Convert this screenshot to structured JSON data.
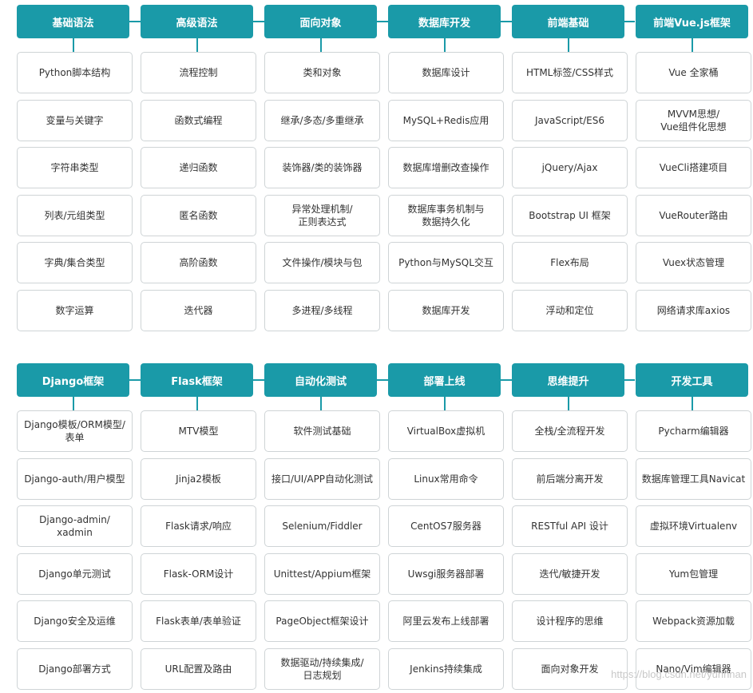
{
  "sections": [
    {
      "columns": [
        {
          "title": "基础语法",
          "items": [
            "Python脚本结构",
            "变量与关键字",
            "字符串类型",
            "列表/元组类型",
            "字典/集合类型",
            "数字运算"
          ]
        },
        {
          "title": "高级语法",
          "items": [
            "流程控制",
            "函数式编程",
            "递归函数",
            "匿名函数",
            "高阶函数",
            "迭代器"
          ]
        },
        {
          "title": "面向对象",
          "items": [
            "类和对象",
            "继承/多态/多重继承",
            "装饰器/类的装饰器",
            "异常处理机制/\n正则表达式",
            "文件操作/模块与包",
            "多进程/多线程"
          ]
        },
        {
          "title": "数据库开发",
          "items": [
            "数据库设计",
            "MySQL+Redis应用",
            "数据库增删改查操作",
            "数据库事务机制与\n数据持久化",
            "Python与MySQL交互",
            "数据库开发"
          ]
        },
        {
          "title": "前端基础",
          "items": [
            "HTML标签/CSS样式",
            "JavaScript/ES6",
            "jQuery/Ajax",
            "Bootstrap UI 框架",
            "Flex布局",
            "浮动和定位"
          ]
        },
        {
          "title": "前端Vue.js框架",
          "items": [
            "Vue 全家桶",
            "MVVM思想/\nVue组件化思想",
            "VueCli搭建项目",
            "VueRouter路由",
            "Vuex状态管理",
            "网络请求库axios"
          ]
        }
      ]
    },
    {
      "columns": [
        {
          "title": "Django框架",
          "items": [
            "Django模板/ORM模型/\n表单",
            "Django-auth/用户模型",
            "Django-admin/\nxadmin",
            "Django单元测试",
            "Django安全及运维",
            "Django部署方式"
          ]
        },
        {
          "title": "Flask框架",
          "items": [
            "MTV模型",
            "Jinja2模板",
            "Flask请求/响应",
            "Flask-ORM设计",
            "Flask表单/表单验证",
            "URL配置及路由"
          ]
        },
        {
          "title": "自动化测试",
          "items": [
            "软件测试基础",
            "接口/UI/APP自动化测试",
            "Selenium/Fiddler",
            "Unittest/Appium框架",
            "PageObject框架设计",
            "数据驱动/持续集成/\n日志规划"
          ]
        },
        {
          "title": "部署上线",
          "items": [
            "VirtualBox虚拟机",
            "Linux常用命令",
            "CentOS7服务器",
            "Uwsgi服务器部署",
            "阿里云发布上线部署",
            "Jenkins持续集成"
          ]
        },
        {
          "title": "思维提升",
          "items": [
            "全栈/全流程开发",
            "前后端分离开发",
            "RESTful API 设计",
            "迭代/敏捷开发",
            "设计程序的思维",
            "面向对象开发"
          ]
        },
        {
          "title": "开发工具",
          "items": [
            "Pycharm编辑器",
            "数据库管理工具Navicat",
            "虚拟环境Virtualenv",
            "Yum包管理",
            "Webpack资源加载",
            "Nano/Vim编辑器"
          ]
        }
      ]
    }
  ],
  "watermark": "https://blog.csdn.net/yunhnan",
  "colors": {
    "header": "#1a9aa8",
    "cell_border": "#cfd4d6"
  }
}
